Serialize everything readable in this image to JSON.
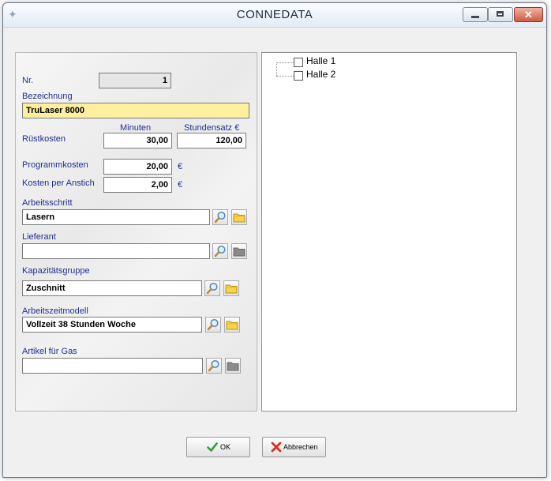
{
  "window": {
    "title": "CONNEDATA"
  },
  "form": {
    "nr": {
      "label": "Nr.",
      "value": "1"
    },
    "bezeichnung": {
      "label": "Bezeichnung",
      "value": "TruLaser 8000"
    },
    "ruestkosten": {
      "label": "Rüstkosten",
      "minuten_header": "Minuten",
      "stundensatz_header": "Stundensatz €",
      "minuten": "30,00",
      "stundensatz": "120,00"
    },
    "programmkosten": {
      "label": "Programmkosten",
      "value": "20,00",
      "unit": "€"
    },
    "kosten_anstich": {
      "label": "Kosten per Anstich",
      "value": "2,00",
      "unit": "€"
    },
    "arbeitsschritt": {
      "label": "Arbeitsschritt",
      "value": "Lasern"
    },
    "lieferant": {
      "label": "Lieferant",
      "value": ""
    },
    "kapazitaetsgruppe": {
      "label": "Kapazitätsgruppe",
      "value": "Zuschnitt"
    },
    "arbeitszeitmodell": {
      "label": "Arbeitszeitmodell",
      "value": "Vollzeit 38 Stunden Woche"
    },
    "artikel_gas": {
      "label": "Artikel für Gas",
      "value": ""
    }
  },
  "tree": {
    "items": [
      {
        "label": "Halle 1"
      },
      {
        "label": "Halle 2"
      }
    ]
  },
  "buttons": {
    "ok": "OK",
    "cancel": "Abbrechen"
  },
  "colors": {
    "label_blue": "#1f2f8f",
    "highlight_yellow": "#fff0a0",
    "ok_green": "#2e9e2e",
    "cancel_red": "#d83020"
  },
  "icons": [
    "search-icon",
    "folder-icon",
    "folder-disabled-icon",
    "check-icon",
    "cross-icon"
  ]
}
